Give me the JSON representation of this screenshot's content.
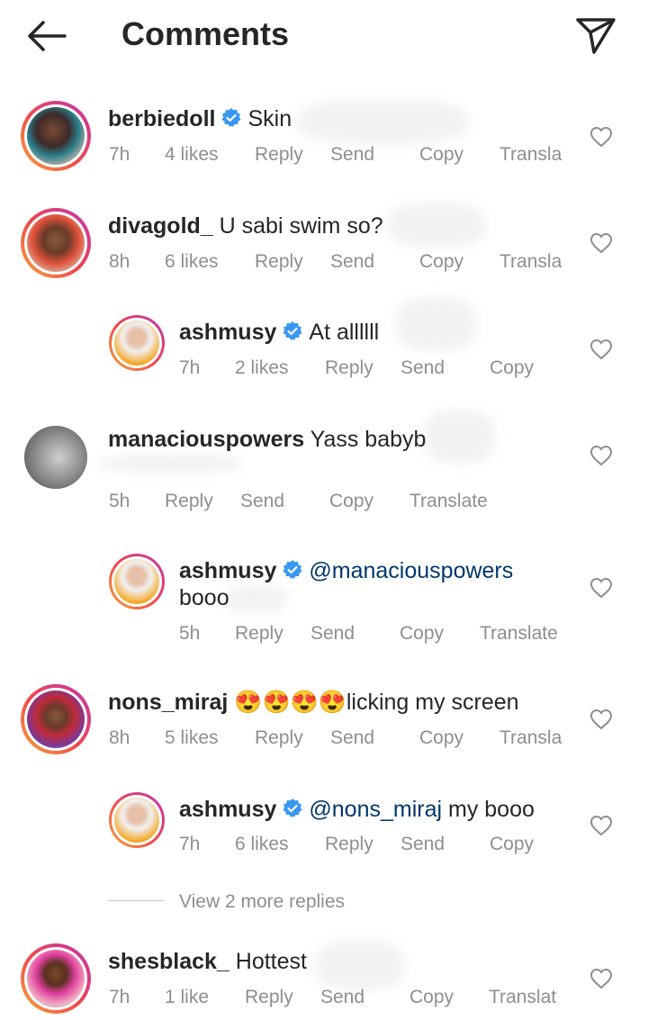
{
  "header": {
    "title": "Comments"
  },
  "comments": [
    {
      "username": "berbiedoll",
      "verified": true,
      "text": "Skin",
      "time": "7h",
      "likes": "4 likes",
      "reply": "Reply",
      "send": "Send",
      "copy": "Copy",
      "translate": "Transla"
    },
    {
      "username": "divagold_",
      "verified": false,
      "text": "U sabi swim so?",
      "time": "8h",
      "likes": "6 likes",
      "reply": "Reply",
      "send": "Send",
      "copy": "Copy",
      "translate": "Transla"
    },
    {
      "username": "ashmusy",
      "verified": true,
      "text": "At allllll",
      "time": "7h",
      "likes": "2 likes",
      "reply": "Reply",
      "send": "Send",
      "copy": "Copy"
    },
    {
      "username": "manaciouspowers",
      "verified": false,
      "text": "Yass babyb",
      "time": "5h",
      "reply": "Reply",
      "send": "Send",
      "copy": "Copy",
      "translate": "Translate"
    },
    {
      "username": "ashmusy",
      "verified": true,
      "mention": "@manaciouspowers",
      "text2": "booo",
      "time": "5h",
      "reply": "Reply",
      "send": "Send",
      "copy": "Copy",
      "translate": "Translate"
    },
    {
      "username": "nons_miraj",
      "verified": false,
      "emojis": "😍😍😍😍",
      "text": "licking my screen",
      "time": "8h",
      "likes": "5 likes",
      "reply": "Reply",
      "send": "Send",
      "copy": "Copy",
      "translate": "Transla"
    },
    {
      "username": "ashmusy",
      "verified": true,
      "mention": "@nons_miraj",
      "text": "my booo",
      "time": "7h",
      "likes": "6 likes",
      "reply": "Reply",
      "send": "Send",
      "copy": "Copy"
    },
    {
      "username": "shesblack_",
      "verified": false,
      "text": "Hottest",
      "time": "7h",
      "likes": "1 like",
      "reply": "Reply",
      "send": "Send",
      "copy": "Copy",
      "translate": "Translat"
    }
  ],
  "view_more": "View 2 more replies",
  "colors": {
    "verified": "#3897f0",
    "mention": "#00376b",
    "meta": "#8e8e8e",
    "text": "#262626"
  }
}
